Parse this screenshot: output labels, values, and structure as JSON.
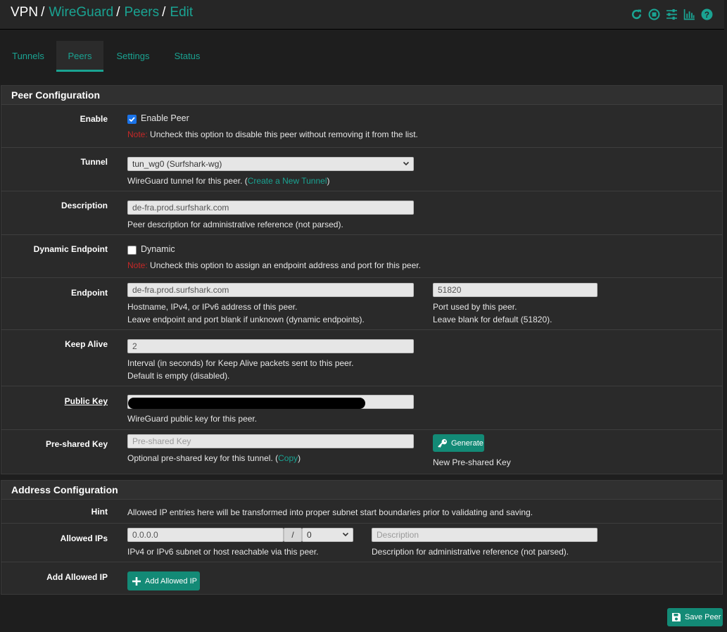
{
  "breadcrumb": {
    "root": "VPN",
    "sep": "/",
    "items": [
      "WireGuard",
      "Peers",
      "Edit"
    ]
  },
  "header_icons": [
    "reload-icon",
    "stop-icon",
    "sliders-icon",
    "chart-icon",
    "help-icon"
  ],
  "tabs": [
    {
      "label": "Tunnels",
      "active": false
    },
    {
      "label": "Peers",
      "active": true
    },
    {
      "label": "Settings",
      "active": false
    },
    {
      "label": "Status",
      "active": false
    }
  ],
  "peer_config": {
    "title": "Peer Configuration",
    "enable": {
      "label": "Enable",
      "checkbox_label": "Enable Peer",
      "checked": true,
      "note_prefix": "Note:",
      "note": " Uncheck this option to disable this peer without removing it from the list."
    },
    "tunnel": {
      "label": "Tunnel",
      "value": "tun_wg0 (Surfshark-wg)",
      "help_prefix": "WireGuard tunnel for this peer. (",
      "help_link": "Create a New Tunnel",
      "help_suffix": ")"
    },
    "description": {
      "label": "Description",
      "value": "de-fra.prod.surfshark.com",
      "help": "Peer description for administrative reference (not parsed)."
    },
    "dynamic": {
      "label": "Dynamic Endpoint",
      "checkbox_label": "Dynamic",
      "checked": false,
      "note_prefix": "Note:",
      "note": " Uncheck this option to assign an endpoint address and port for this peer."
    },
    "endpoint": {
      "label": "Endpoint",
      "host_value": "de-fra.prod.surfshark.com",
      "host_help_1": "Hostname, IPv4, or IPv6 address of this peer.",
      "host_help_2": "Leave endpoint and port blank if unknown (dynamic endpoints).",
      "port_value": "51820",
      "port_help_1": "Port used by this peer.",
      "port_help_2": "Leave blank for default (51820)."
    },
    "keepalive": {
      "label": "Keep Alive",
      "value": "2",
      "help_1": "Interval (in seconds) for Keep Alive packets sent to this peer.",
      "help_2": "Default is empty (disabled)."
    },
    "public_key": {
      "label": "Public Key",
      "help": "WireGuard public key for this peer."
    },
    "psk": {
      "label": "Pre-shared Key",
      "placeholder": "Pre-shared Key",
      "help_prefix": "Optional pre-shared key for this tunnel. (",
      "help_link": "Copy",
      "help_suffix": ")",
      "generate_label": "Generate",
      "generate_help": "New Pre-shared Key"
    }
  },
  "address_config": {
    "title": "Address Configuration",
    "hint": {
      "label": "Hint",
      "text": "Allowed IP entries here will be transformed into proper subnet start boundaries prior to validating and saving."
    },
    "allowed_ips": {
      "label": "Allowed IPs",
      "ip_value": "0.0.0.0",
      "slash": "/",
      "mask_value": "0",
      "desc_placeholder": "Description",
      "ip_help": "IPv4 or IPv6 subnet or host reachable via this peer.",
      "desc_help": "Description for administrative reference (not parsed)."
    },
    "add": {
      "label": "Add Allowed IP",
      "button": "Add Allowed IP"
    }
  },
  "save_button": "Save Peer",
  "colors": {
    "accent": "#1aa392",
    "button": "#138a76",
    "note": "#c62828",
    "background": "#1e1e1e",
    "panel": "#2a2a2a"
  }
}
